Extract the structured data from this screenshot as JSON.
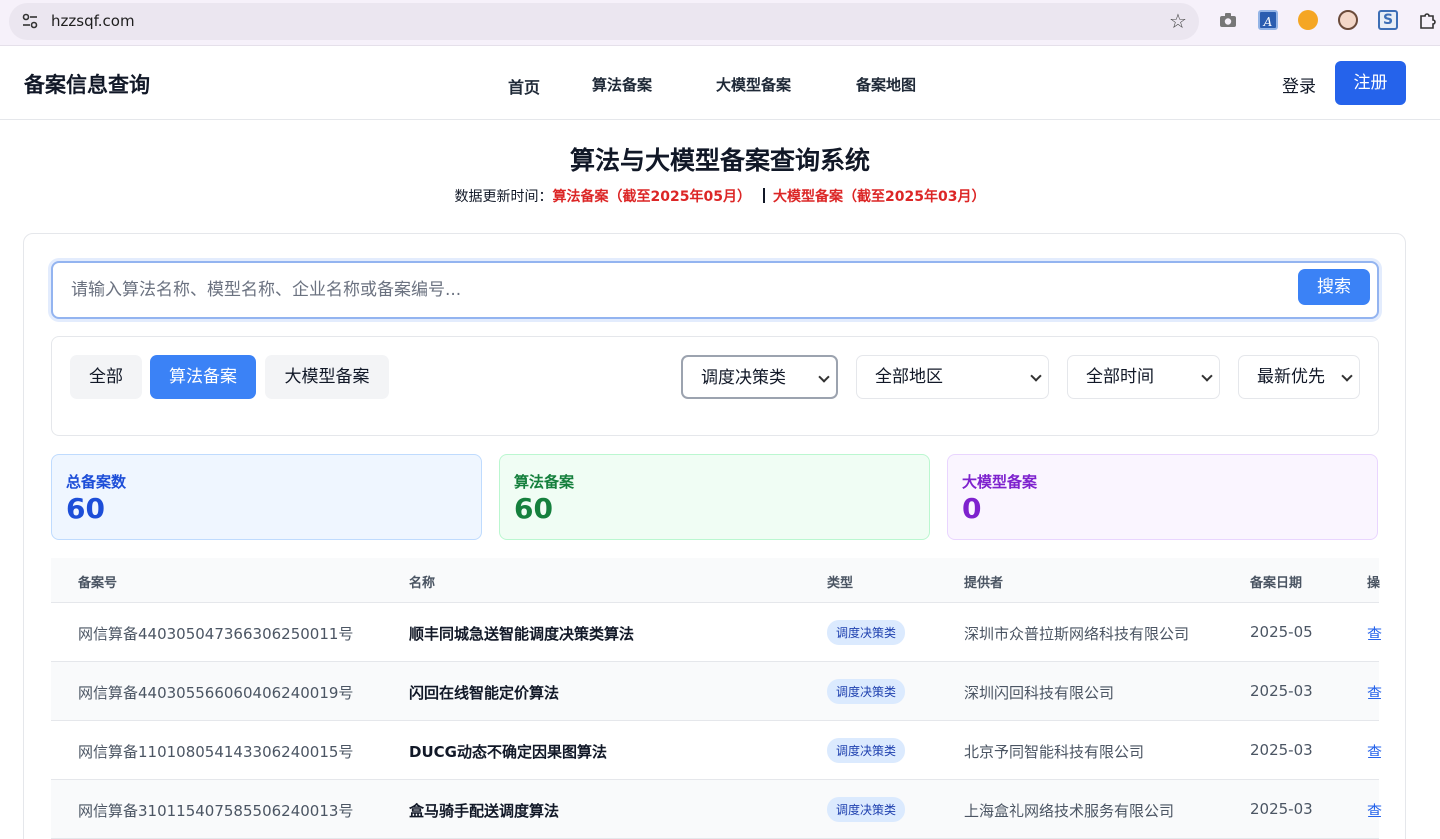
{
  "browser": {
    "url": "hzzsqf.com",
    "ext_a_label": "A",
    "ext_s_label": "S"
  },
  "header": {
    "brand": "备案信息查询",
    "nav": [
      "首页",
      "算法备案",
      "大模型备案",
      "备案地图"
    ],
    "login": "登录",
    "register": "注册"
  },
  "hero": {
    "title": "算法与大模型备案查询系统",
    "update_prefix": "数据更新时间：",
    "algo_update": "算法备案（截至2025年05月）",
    "llm_update": "大模型备案（截至2025年03月）"
  },
  "search": {
    "placeholder": "请输入算法名称、模型名称、企业名称或备案编号...",
    "button": "搜索"
  },
  "filters": {
    "chips": [
      "全部",
      "算法备案",
      "大模型备案"
    ],
    "active_chip": "算法备案",
    "type_select": "调度决策类",
    "region_select": "全部地区",
    "time_select": "全部时间",
    "sort_select": "最新优先"
  },
  "stats": {
    "total_label": "总备案数",
    "total_value": "60",
    "algo_label": "算法备案",
    "algo_value": "60",
    "llm_label": "大模型备案",
    "llm_value": "0"
  },
  "table": {
    "headers": [
      "备案号",
      "名称",
      "类型",
      "提供者",
      "备案日期",
      "操"
    ],
    "rows": [
      {
        "no": "网信算备440305047366306250011号",
        "name": "顺丰同城急送智能调度决策类算法",
        "type": "调度决策类",
        "provider": "深圳市众普拉斯网络科技有限公司",
        "date": "2025-05",
        "action": "查"
      },
      {
        "no": "网信算备440305566060406240019号",
        "name": "闪回在线智能定价算法",
        "type": "调度决策类",
        "provider": "深圳闪回科技有限公司",
        "date": "2025-03",
        "action": "查"
      },
      {
        "no": "网信算备110108054143306240015号",
        "name": "DUCG动态不确定因果图算法",
        "type": "调度决策类",
        "provider": "北京予同智能科技有限公司",
        "date": "2025-03",
        "action": "查"
      },
      {
        "no": "网信算备310115407585506240013号",
        "name": "盒马骑手配送调度算法",
        "type": "调度决策类",
        "provider": "上海盒礼网络技术服务有限公司",
        "date": "2025-03",
        "action": "查"
      }
    ]
  },
  "colors": {
    "primary": "#2563eb",
    "chip_active": "#3b82f6",
    "update_red": "#dc2626"
  }
}
